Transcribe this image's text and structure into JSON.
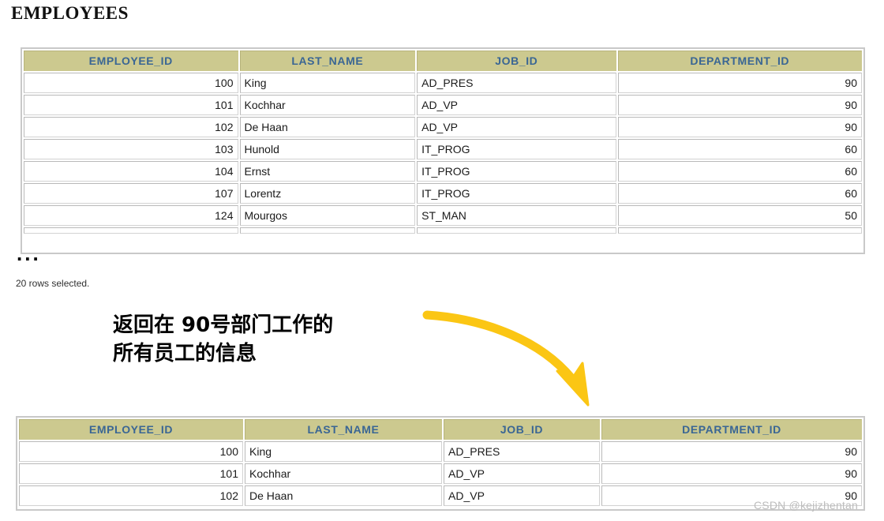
{
  "title": "EMPLOYEES",
  "colors": {
    "header_bg": "#ccc98f",
    "header_text": "#3a6694",
    "arrow": "#fbc614",
    "border": "#c9c9c9",
    "watermark": "#bdbdbd"
  },
  "source_table": {
    "columns": [
      "EMPLOYEE_ID",
      "LAST_NAME",
      "JOB_ID",
      "DEPARTMENT_ID"
    ],
    "rows": [
      [
        "100",
        "King",
        "AD_PRES",
        "90"
      ],
      [
        "101",
        "Kochhar",
        "AD_VP",
        "90"
      ],
      [
        "102",
        "De Haan",
        "AD_VP",
        "90"
      ],
      [
        "103",
        "Hunold",
        "IT_PROG",
        "60"
      ],
      [
        "104",
        "Ernst",
        "IT_PROG",
        "60"
      ],
      [
        "107",
        "Lorentz",
        "IT_PROG",
        "60"
      ],
      [
        "124",
        "Mourgos",
        "ST_MAN",
        "50"
      ]
    ],
    "truncated_marker": "...",
    "rows_selected": "20 rows selected."
  },
  "annotation": {
    "line1": "返回在 90号部门工作的",
    "line2": "所有员工的信息"
  },
  "arrow": {
    "name": "curved-down-right-arrow",
    "color": "#fbc614"
  },
  "result_table": {
    "columns": [
      "EMPLOYEE_ID",
      "LAST_NAME",
      "JOB_ID",
      "DEPARTMENT_ID"
    ],
    "rows": [
      [
        "100",
        "King",
        "AD_PRES",
        "90"
      ],
      [
        "101",
        "Kochhar",
        "AD_VP",
        "90"
      ],
      [
        "102",
        "De Haan",
        "AD_VP",
        "90"
      ]
    ]
  },
  "watermark": "CSDN @kejizhentan"
}
